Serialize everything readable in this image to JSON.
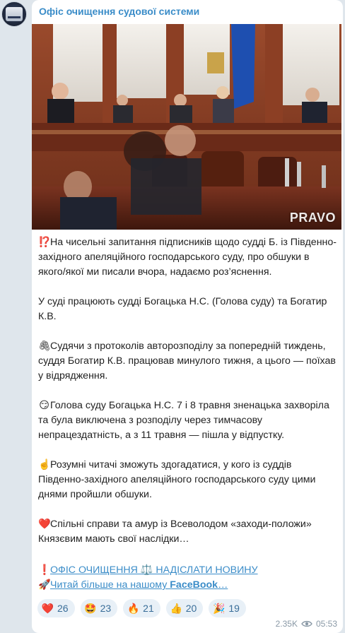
{
  "channel": {
    "name": "Офіс очищення судової системи"
  },
  "photo": {
    "watermark": "PRAVO"
  },
  "message": {
    "paragraphs": [
      {
        "emoji": "⁉️",
        "text": "На чисельні запитання підписників щодо судді Б. із Південно-західного апеляційного господарського суду, про обшуки в якого/якої ми писали вчора, надаємо роз’яснення."
      },
      {
        "emoji": "",
        "text": "У суді працюють судді Богацька Н.С. (Голова суду) та Богатир К.В."
      },
      {
        "emoji": "🖇",
        "text": "Судячи з протоколів авторозподілу за попередній тиждень, суддя Богатир К.В. працював минулого тижня, а цього — поїхав у відрядження."
      },
      {
        "emoji": "😏",
        "text": "Голова суду Богацька Н.С. 7 і 8 травня зненацька захворіла та була виключена з розподілу через тимчасову непрацездатність, а з 11 травня — пішла у відпустку."
      },
      {
        "emoji": "☝️",
        "text": "Розумні читачі зможуть здогадатися, у кого із суддів Південно-західного апеляційного господарського суду цими днями пройшли обшуки."
      },
      {
        "emoji": "❤️",
        "text": "Спільні справи та амур із Всеволодом «заходи-положи» Князєвим мають свої наслідки…"
      }
    ],
    "link1": {
      "emoji": "❗️",
      "text": "ОФІС ОЧИЩЕННЯ ⚖️ НАДІСЛАТИ НОВИНУ"
    },
    "link2": {
      "emoji": "🚀",
      "prefix": "Читай більше на нашому ",
      "bold": "FaceBook",
      "suffix": "…"
    }
  },
  "reactions": [
    {
      "icon": "heart-icon",
      "emoji": "❤️",
      "count": "26"
    },
    {
      "icon": "star-struck-icon",
      "emoji": "🤩",
      "count": "23"
    },
    {
      "icon": "fire-icon",
      "emoji": "🔥",
      "count": "21"
    },
    {
      "icon": "thumbs-up-icon",
      "emoji": "👍",
      "count": "20"
    },
    {
      "icon": "party-popper-icon",
      "emoji": "🎉",
      "count": "19"
    }
  ],
  "meta": {
    "views": "2.35K",
    "time": "05:53"
  },
  "colors": {
    "accent": "#3a8cc8",
    "bubble": "#ffffff",
    "background": "#dfe6ec"
  }
}
